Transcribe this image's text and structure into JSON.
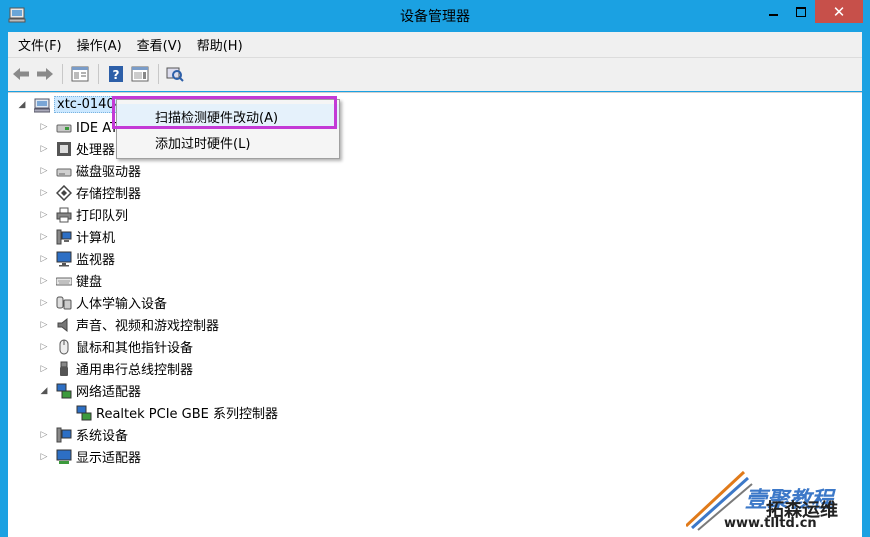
{
  "window": {
    "title": "设备管理器",
    "close_glyph": "✕",
    "accent_color": "#1ba1e2",
    "close_color": "#c7504a"
  },
  "menubar": {
    "items": [
      {
        "label": "文件(F)"
      },
      {
        "label": "操作(A)"
      },
      {
        "label": "查看(V)"
      },
      {
        "label": "帮助(H)"
      }
    ]
  },
  "toolbar": {
    "icons": [
      "back-arrow-icon",
      "forward-arrow-icon",
      "properties-icon",
      "help-icon",
      "show-hide-icon",
      "scan-hardware-icon"
    ]
  },
  "tree": {
    "root": {
      "label": "xtc-01404301157",
      "icon": "computer-icon",
      "expanded": true
    },
    "categories": [
      {
        "label": "IDE ATA/ATAPI 控制器",
        "icon": "ide-controller-icon",
        "expanded": false
      },
      {
        "label": "处理器",
        "icon": "processor-icon",
        "expanded": false
      },
      {
        "label": "磁盘驱动器",
        "icon": "disk-drive-icon",
        "expanded": false
      },
      {
        "label": "存储控制器",
        "icon": "storage-controller-icon",
        "expanded": false
      },
      {
        "label": "打印队列",
        "icon": "printer-icon",
        "expanded": false
      },
      {
        "label": "计算机",
        "icon": "computer-icon",
        "expanded": false
      },
      {
        "label": "监视器",
        "icon": "monitor-icon",
        "expanded": false
      },
      {
        "label": "键盘",
        "icon": "keyboard-icon",
        "expanded": false
      },
      {
        "label": "人体学输入设备",
        "icon": "hid-icon",
        "expanded": false
      },
      {
        "label": "声音、视频和游戏控制器",
        "icon": "speaker-icon",
        "expanded": false
      },
      {
        "label": "鼠标和其他指针设备",
        "icon": "mouse-icon",
        "expanded": false
      },
      {
        "label": "通用串行总线控制器",
        "icon": "usb-icon",
        "expanded": false
      },
      {
        "label": "网络适配器",
        "icon": "network-adapter-icon",
        "expanded": true
      },
      {
        "label": "系统设备",
        "icon": "system-device-icon",
        "expanded": false
      },
      {
        "label": "显示适配器",
        "icon": "display-adapter-icon",
        "expanded": false
      }
    ],
    "network_child": {
      "label": "Realtek PCIe GBE 系列控制器",
      "icon": "network-adapter-icon"
    }
  },
  "context_menu": {
    "items": [
      {
        "label": "扫描检测硬件改动(A)",
        "highlighted": true
      },
      {
        "label": "添加过时硬件(L)"
      }
    ],
    "highlight_color": "#c33ad6"
  },
  "watermark": {
    "line1": "壹聚教程",
    "line2": "拓森运维",
    "line3": "www.tlltd.cn"
  }
}
